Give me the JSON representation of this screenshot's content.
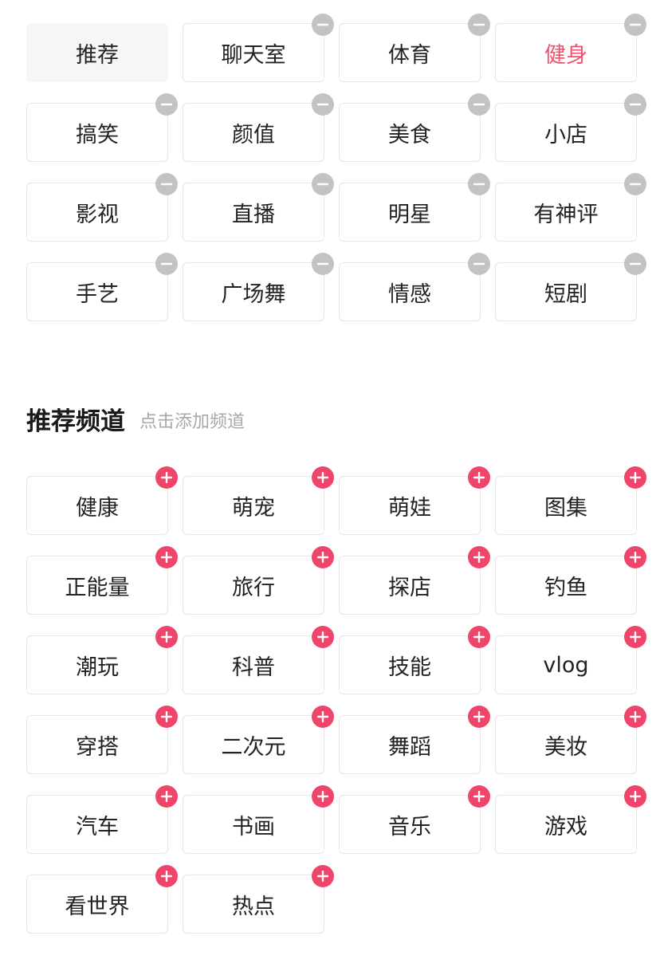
{
  "my_channels": [
    {
      "label": "推荐",
      "removable": false,
      "active": false
    },
    {
      "label": "聊天室",
      "removable": true,
      "active": false
    },
    {
      "label": "体育",
      "removable": true,
      "active": false
    },
    {
      "label": "健身",
      "removable": true,
      "active": true
    },
    {
      "label": "搞笑",
      "removable": true,
      "active": false
    },
    {
      "label": "颜值",
      "removable": true,
      "active": false
    },
    {
      "label": "美食",
      "removable": true,
      "active": false
    },
    {
      "label": "小店",
      "removable": true,
      "active": false
    },
    {
      "label": "影视",
      "removable": true,
      "active": false
    },
    {
      "label": "直播",
      "removable": true,
      "active": false
    },
    {
      "label": "明星",
      "removable": true,
      "active": false
    },
    {
      "label": "有神评",
      "removable": true,
      "active": false
    },
    {
      "label": "手艺",
      "removable": true,
      "active": false
    },
    {
      "label": "广场舞",
      "removable": true,
      "active": false
    },
    {
      "label": "情感",
      "removable": true,
      "active": false
    },
    {
      "label": "短剧",
      "removable": true,
      "active": false
    }
  ],
  "recommended_section": {
    "title": "推荐频道",
    "hint": "点击添加频道"
  },
  "recommended_channels": [
    {
      "label": "健康"
    },
    {
      "label": "萌宠"
    },
    {
      "label": "萌娃"
    },
    {
      "label": "图集"
    },
    {
      "label": "正能量"
    },
    {
      "label": "旅行"
    },
    {
      "label": "探店"
    },
    {
      "label": "钓鱼"
    },
    {
      "label": "潮玩"
    },
    {
      "label": "科普"
    },
    {
      "label": "技能"
    },
    {
      "label": "vlog"
    },
    {
      "label": "穿搭"
    },
    {
      "label": "二次元"
    },
    {
      "label": "舞蹈"
    },
    {
      "label": "美妆"
    },
    {
      "label": "汽车"
    },
    {
      "label": "书画"
    },
    {
      "label": "音乐"
    },
    {
      "label": "游戏"
    },
    {
      "label": "看世界"
    },
    {
      "label": "热点"
    }
  ],
  "icons": {
    "remove": "minus-icon",
    "add": "plus-icon"
  },
  "colors": {
    "accent": "#f0456a",
    "active_text": "#f0506e",
    "remove_badge": "#c3c3c3",
    "tile_border": "#e7e7e7",
    "fixed_tile_bg": "#f6f6f6"
  }
}
